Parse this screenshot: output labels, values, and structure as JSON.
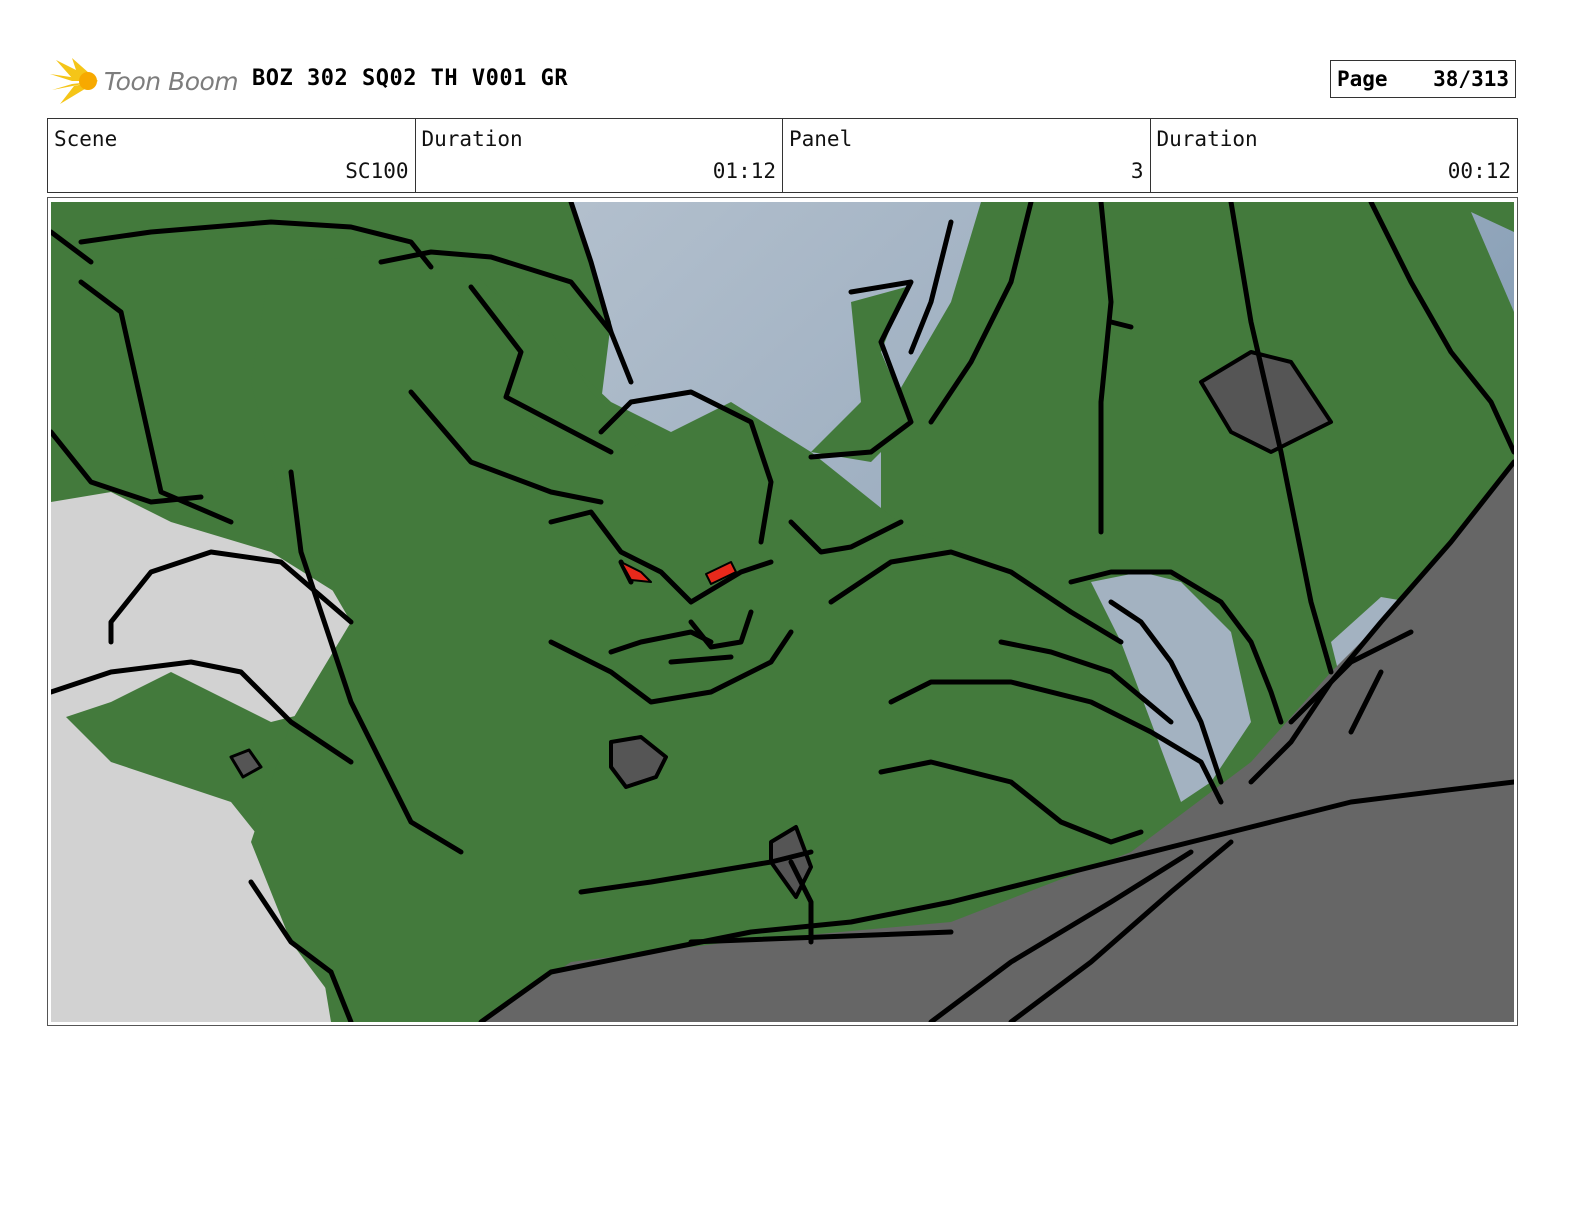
{
  "header": {
    "logo_text": "Toon Boom",
    "title": "BOZ 302 SQ02 TH V001 GR",
    "page_label": "Page",
    "page_value": "38/313"
  },
  "info": {
    "scene_label": "Scene",
    "scene_value": "SC100",
    "scene_duration_label": "Duration",
    "scene_duration_value": "01:12",
    "panel_label": "Panel",
    "panel_value": "3",
    "panel_duration_label": "Duration",
    "panel_duration_value": "00:12"
  },
  "colors": {
    "creature_green": "#437a3c",
    "sky": "#a9b8c6",
    "rock": "#666666",
    "cloud": "#d2d2d2",
    "eyes": "#e8291b",
    "logo_flare": "#f5c518"
  }
}
